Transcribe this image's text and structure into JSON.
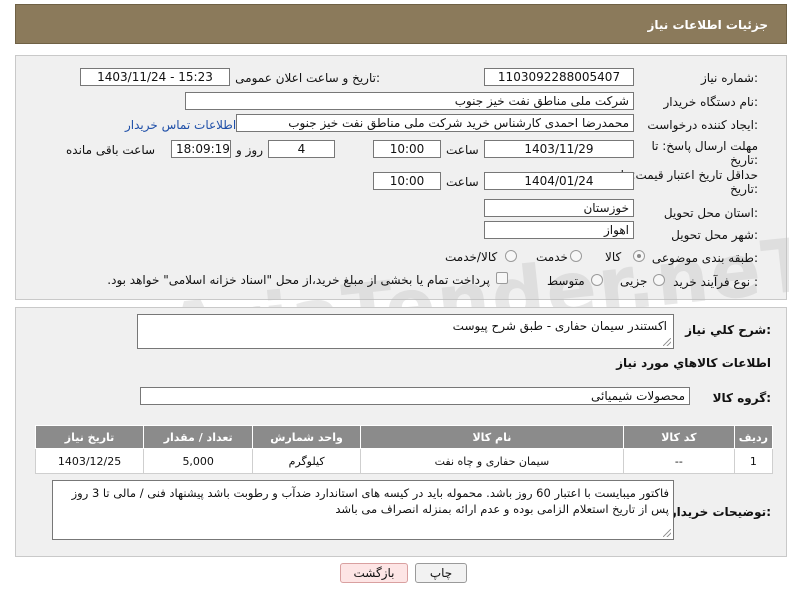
{
  "header": {
    "title": "جزئیات اطلاعات نیاز"
  },
  "form": {
    "need_number": {
      "label": "شماره نیاز:",
      "value": "1103092288005407"
    },
    "announce_datetime": {
      "label": "تاریخ و ساعت اعلان عمومی:",
      "value": "1403/11/24 - 15:23"
    },
    "buyer_org": {
      "label": "نام دستگاه خریدار:",
      "value": "شرکت ملی مناطق نفت خیز جنوب"
    },
    "requester": {
      "label": "ایجاد کننده درخواست:",
      "value": "محمدرضا احمدی  کارشناس خرید  شرکت ملی مناطق نفت خیز جنوب",
      "contact_link": "اطلاعات تماس خریدار"
    },
    "reply_deadline": {
      "label_line1": "مهلت ارسال پاسخ: تا",
      "label_line2": "تاریخ:",
      "date": "1403/11/29",
      "time_label": "ساعت",
      "time": "10:00",
      "days": "4",
      "days_label": "روز و",
      "remaining": "18:09:19",
      "remaining_label": "ساعت باقی مانده"
    },
    "price_validity": {
      "label_line1": "حداقل تاریخ اعتبار قیمت: تا",
      "label_line2": "تاریخ:",
      "date": "1404/01/24",
      "time_label": "ساعت",
      "time": "10:00"
    },
    "province": {
      "label": "استان محل تحویل:",
      "value": "خوزستان"
    },
    "city": {
      "label": "شهر محل تحویل:",
      "value": "اهواز"
    },
    "category": {
      "label": "طبقه بندی موضوعی:",
      "options": [
        "کالا",
        "خدمت",
        "کالا/خدمت"
      ],
      "selected": "کالا"
    },
    "purchase_type": {
      "label": "نوع فرآیند خرید :",
      "options": [
        "جزیی",
        "متوسط"
      ],
      "selected": "",
      "payment_note": "پرداخت تمام یا بخشی از مبلغ خرید،از محل \"اسناد خزانه اسلامی\" خواهد بود."
    }
  },
  "details": {
    "summary_label": "شرح کلي نياز:",
    "summary_value": "اکستندر سیمان حفاری - طبق شرح پیوست",
    "goods_info_title": "اطلاعات کالاهاي مورد نياز",
    "goods_group_label": "گروه کالا:",
    "goods_group_value": "محصولات شیمیائی",
    "table": {
      "headers": [
        "ردیف",
        "کد کالا",
        "نام کالا",
        "واحد شمارش",
        "تعداد / مقدار",
        "تاریخ نیاز"
      ],
      "rows": [
        [
          "1",
          "--",
          "سیمان حفاری و چاه نفت",
          "کیلوگرم",
          "5,000",
          "1403/12/25"
        ]
      ]
    },
    "buyer_notes_label": "توضیحات خریدار:",
    "buyer_notes_value": "فاکتور میبایست با اعتبار 60 روز باشد. محموله باید در کیسه های استاندارد  ضدآب و  رطوبت   باشد پیشنهاد فنی / مالی تا 3 روز پس از تاریخ استعلام الزامی بوده و عدم ارائه بمنزله انصراف می باشد"
  },
  "buttons": {
    "print": "چاپ",
    "back": "بازگشت"
  },
  "watermark": "AriaTender.neT"
}
